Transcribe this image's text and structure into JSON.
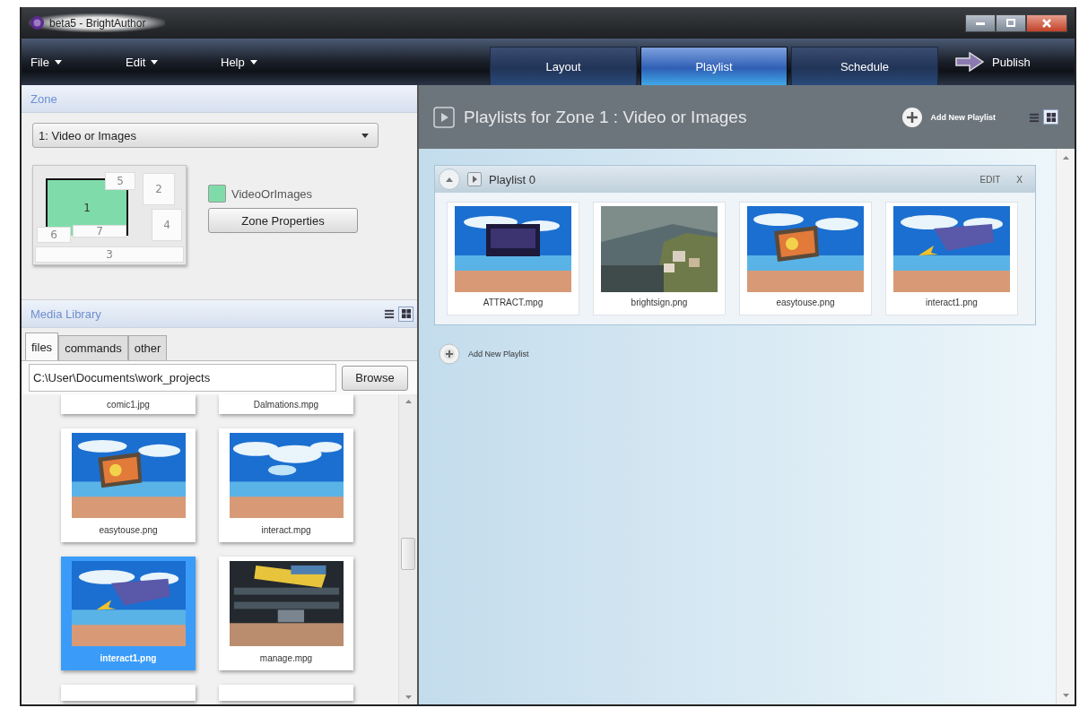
{
  "window": {
    "title": "beta5 - BrightAuthor"
  },
  "menu": [
    {
      "label": "File"
    },
    {
      "label": "Edit"
    },
    {
      "label": "Help"
    }
  ],
  "tabs": [
    {
      "label": "Layout",
      "selected": false
    },
    {
      "label": "Playlist",
      "selected": true
    },
    {
      "label": "Schedule",
      "selected": false
    }
  ],
  "publish": {
    "label": "Publish"
  },
  "zone_panel": {
    "title": "Zone",
    "zone_select": {
      "value": "1: Video or Images"
    },
    "zones": [
      {
        "label": "1",
        "selected": true
      },
      {
        "label": "2",
        "selected": false
      },
      {
        "label": "3",
        "selected": false
      },
      {
        "label": "4",
        "selected": false
      },
      {
        "label": "5",
        "selected": false
      },
      {
        "label": "6",
        "selected": false
      },
      {
        "label": "7",
        "selected": false
      }
    ],
    "zone_type": {
      "label": "VideoOrImages",
      "color": "#7fdcaa"
    },
    "properties_button": "Zone Properties"
  },
  "media_library": {
    "title": "Media Library",
    "views": [
      {
        "kind": "list",
        "selected": false
      },
      {
        "kind": "grid",
        "selected": true
      }
    ],
    "tabs": [
      {
        "label": "files",
        "selected": true
      },
      {
        "label": "commands",
        "selected": false
      },
      {
        "label": "other",
        "selected": false
      }
    ],
    "path": {
      "value": "C:\\User\\Documents\\work_projects"
    },
    "browse_button": "Browse",
    "files": [
      {
        "kind": "caption",
        "name": "comic1.jpg",
        "selected": false
      },
      {
        "kind": "caption",
        "name": "Dalmations.mpg",
        "selected": false
      },
      {
        "kind": "thumb",
        "name": "easytouse.png",
        "selected": false
      },
      {
        "kind": "thumb",
        "name": "interact.mpg",
        "selected": false
      },
      {
        "kind": "thumb",
        "name": "interact1.png",
        "selected": true
      },
      {
        "kind": "thumb",
        "name": "manage.mpg",
        "selected": false
      },
      {
        "kind": "blank",
        "selected": false
      },
      {
        "kind": "blank",
        "selected": false
      }
    ]
  },
  "playlists_panel": {
    "title": "Playlists for Zone 1 : Video or Images",
    "add_label": "Add New Playlist",
    "views": [
      {
        "kind": "list",
        "selected": false
      },
      {
        "kind": "grid",
        "selected": true
      }
    ],
    "playlists": [
      {
        "name": "Playlist 0",
        "expanded": true,
        "edit": "EDIT",
        "close": "X",
        "items": [
          {
            "name": "ATTRACT.mpg"
          },
          {
            "name": "brightsign.png"
          },
          {
            "name": "easytouse.png"
          },
          {
            "name": "interact1.png"
          }
        ]
      }
    ],
    "add_new": "Add New Playlist"
  }
}
